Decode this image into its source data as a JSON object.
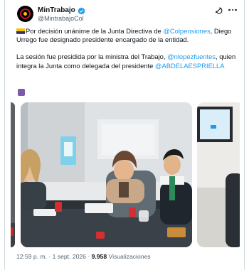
{
  "account": {
    "display_name": "MinTrabajo",
    "handle": "@MintrabajoCol"
  },
  "tweet": {
    "p1_text_a": "Por decisión unánime de la Junta Directiva de ",
    "p1_mention": "@Colpensiones",
    "p1_text_b": ", Diego Urrego fue designado presidente encargado de la entidad.",
    "p2_text_a": "La sesión fue presidida por la ministra del Trabajo, ",
    "p2_mention_a": "@nlopezfuentes",
    "p2_text_b": ", quien integra la Junta como delegada del presidente ",
    "p2_mention_b": "@ABDELAESPRIELLA"
  },
  "footer": {
    "time": "12:59 p. m.",
    "separator": " · ",
    "date": "1 sept. 2026",
    "separator2": " · ",
    "views": "9.958",
    "views_label": " Visualizaciones"
  },
  "icons": {
    "verified": "verified-badge-icon",
    "grok": "grok-icon",
    "more": "more-options-icon",
    "flag": "colombia-flag-icon",
    "purple": "purple-square-emoji"
  },
  "colors": {
    "link": "#1d9bf0",
    "text": "#0f1419",
    "muted": "#536471",
    "verified": "#1d9bf0"
  }
}
